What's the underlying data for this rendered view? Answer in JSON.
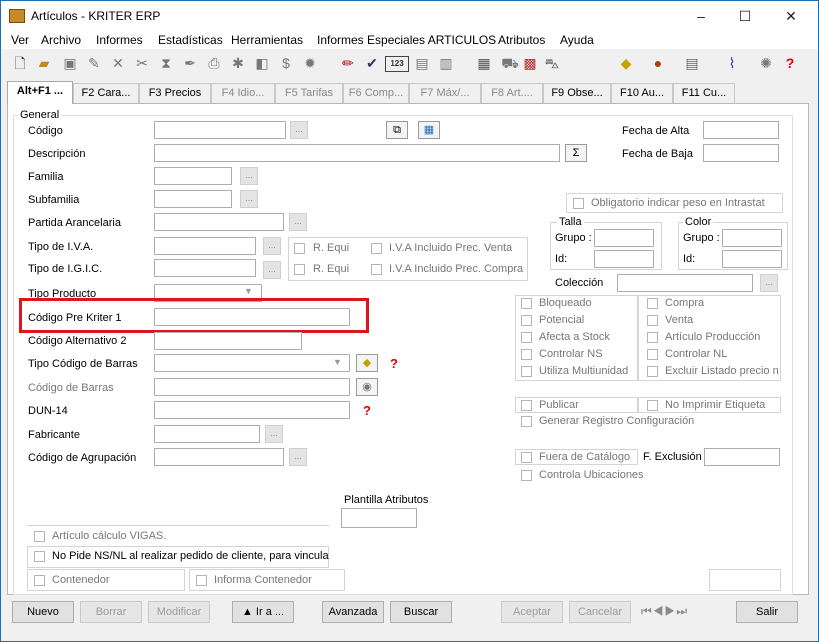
{
  "window": {
    "title": "Artículos - KRITER ERP",
    "controls": [
      "–",
      "☐",
      "✕"
    ]
  },
  "menu": [
    "Ver",
    "Archivo",
    "Informes",
    "Estadísticas",
    "Herramientas",
    "Informes Especiales ARTICULOS",
    "Atributos",
    "Ayuda"
  ],
  "toolbar": {
    "icons": [
      "new-icon",
      "open-folder-icon",
      "save-icon",
      "edit-icon",
      "delete-icon",
      "tools-icon",
      "filter-icon",
      "pen-icon",
      "print-icon",
      "snowflake-icon",
      "box-icon",
      "dollar-icon",
      "gear-icon",
      "pencil-icon",
      "check-icon",
      "numeric-icon",
      "calculator-icon",
      "chart-icon",
      "document-icon",
      "cart-icon",
      "scanner-icon",
      "money-bag-icon",
      "notebook-icon",
      "paperclip-icon",
      "bug-icon",
      "help-icon"
    ],
    "numeric_label": "123"
  },
  "tabs": [
    "Alt+F1 ...",
    "F2 Cara...",
    "F3 Precios",
    "F4 Idio...",
    "F5 Tarifas",
    "F6 Comp...",
    "F7 Máx/...",
    "F8 Art....",
    "F9 Obse...",
    "F10 Au...",
    "F11 Cu..."
  ],
  "general": {
    "group_title": "General",
    "codigo": "Código",
    "descripcion": "Descripción",
    "familia": "Familia",
    "subfamilia": "Subfamilia",
    "partida": "Partida Arancelaria",
    "tipo_iva": "Tipo de I.V.A.",
    "tipo_igic": "Tipo de I.G.I.C.",
    "tipo_producto": "Tipo Producto",
    "codigo_pre_kriter": "Código Pre Kriter 1",
    "codigo_alternativo": "Código Alternativo 2",
    "tipo_codigo_barras": "Tipo Código de Barras",
    "codigo_barras": "Código de Barras",
    "dun14": "DUN-14",
    "fabricante": "Fabricante",
    "codigo_agrupacion": "Código de Agrupación",
    "r_equi": "R. Equi",
    "iva_incluido_venta": "I.V.A Incluido Prec. Venta",
    "iva_incluido_compra": "I.V.A Incluido Prec. Compra",
    "fecha_alta": "Fecha de Alta",
    "fecha_baja": "Fecha de Baja",
    "obligatorio_peso": "Obligatorio indicar peso en Intrastat",
    "talla": "Talla",
    "color": "Color",
    "grupo": "Grupo :",
    "id": "Id:",
    "coleccion": "Colección",
    "sigma": "Σ",
    "ellipsis": "..."
  },
  "flags_left": [
    "Bloqueado",
    "Potencial",
    "Afecta a Stock",
    "Controlar NS",
    "Utiliza Multiunidad"
  ],
  "flags_right": [
    "Compra",
    "Venta",
    "Artículo Producción",
    "Controlar NL",
    "Excluir Listado precio n"
  ],
  "publicar": "Publicar",
  "no_imprimir": "No Imprimir Etiqueta",
  "generar_registro": "Generar Registro Configuración",
  "fuera_catalogo": "Fuera de Catálogo",
  "fecha_exclusion": "F. Exclusión",
  "controla_ubicaciones": "Controla Ubicaciones",
  "plantilla_atributos": "Plantilla Atributos",
  "vigas": "Artículo cálculo VIGAS.",
  "no_pide": "No Pide NS/NL al realizar pedido de cliente, para vincula",
  "contenedor": "Contenedor",
  "informa_contenedor": "Informa Contenedor",
  "buttons": {
    "nuevo": "Nuevo",
    "borrar": "Borrar",
    "modificar": "Modificar",
    "ir_a": "▲ Ir a ...",
    "avanzada": "Avanzada",
    "buscar": "Buscar",
    "aceptar": "Aceptar",
    "cancelar": "Cancelar",
    "salir": "Salir"
  },
  "colors": {
    "highlight": "#e0141e",
    "help_icon": "#dd0000",
    "title_border": "#1c6fb3"
  }
}
